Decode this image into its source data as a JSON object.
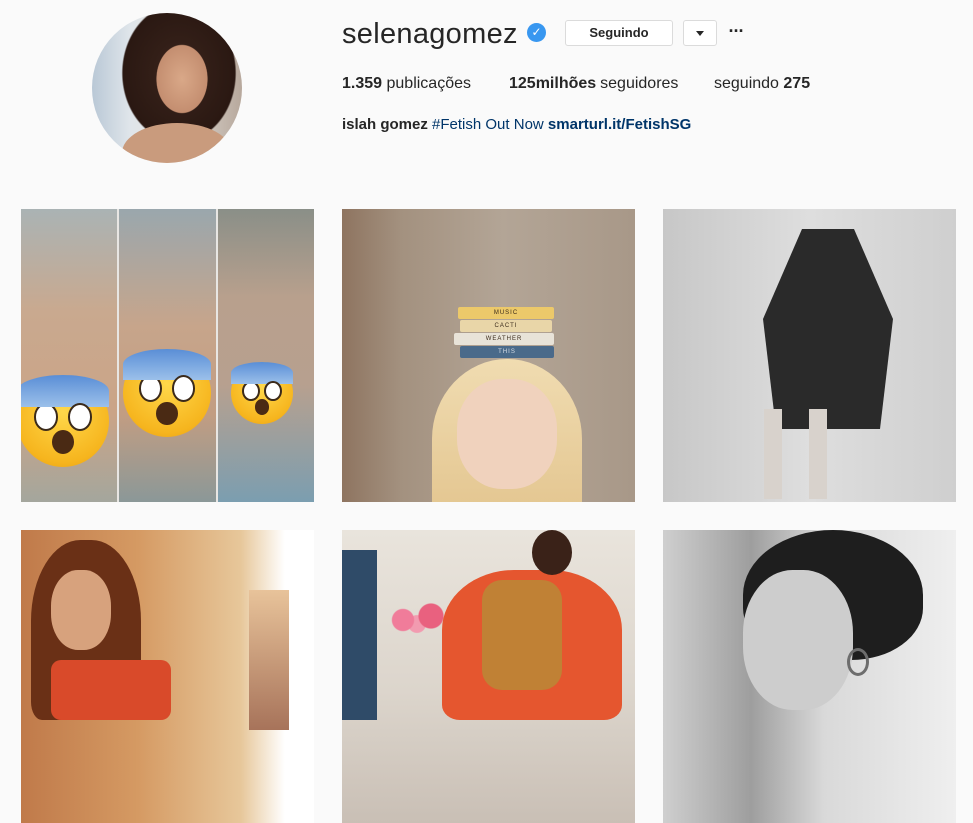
{
  "profile": {
    "username": "selenagomez",
    "verified": true,
    "follow_label": "Seguindo",
    "more_label": "···",
    "stats": {
      "posts_count": "1.359",
      "posts_label": "publicações",
      "followers_count": "125milhões",
      "followers_label": "seguidores",
      "following_label": "seguindo",
      "following_count": "275"
    },
    "bio": {
      "name": "islah gomez",
      "hashtag": "#Fetish Out Now",
      "link": "smarturl.it/FetishSG"
    }
  },
  "posts": [
    {
      "description": "three-panel photo with shocked emojis"
    },
    {
      "description": "woman with books on head",
      "books": [
        "MUSIC",
        "CACTI",
        "WEATHER",
        "THIS"
      ]
    },
    {
      "description": "black and white model in long coat"
    },
    {
      "description": "woman with red handbag"
    },
    {
      "description": "woman on orange chair"
    },
    {
      "description": "black and white portrait smiling"
    }
  ],
  "colors": {
    "verified_blue": "#3897f0",
    "link_blue": "#003569",
    "background": "#fafafa",
    "border": "#dbdbdb"
  }
}
